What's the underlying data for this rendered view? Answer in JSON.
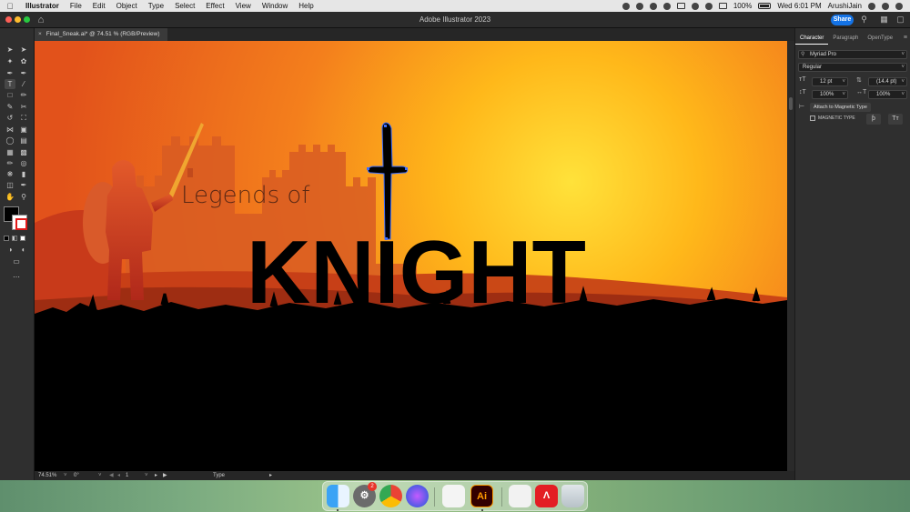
{
  "menubar": {
    "items": [
      "Illustrator",
      "File",
      "Edit",
      "Object",
      "Type",
      "Select",
      "Effect",
      "View",
      "Window",
      "Help"
    ],
    "battery": "100%",
    "clock": "Wed 6:01 PM",
    "user": "ArushiJain"
  },
  "titlebar": {
    "title": "Adobe Illustrator 2023",
    "share_label": "Share"
  },
  "document": {
    "tab_label": "Final_Sneak.ai* @ 74.51 % (RGB/Preview)",
    "close": "×"
  },
  "artwork": {
    "headline_small": "Legends of",
    "headline_big": "KNIGHT",
    "colors": {
      "sky_top": "#e8651c",
      "sky_glow": "#ffd028",
      "silhouette": "#000000",
      "castle": "#d4561d",
      "knight": "#d0421f"
    }
  },
  "status": {
    "zoom": "74.51%",
    "rotation": "0°",
    "artboard": "1",
    "tool": "Type"
  },
  "panel": {
    "tabs": [
      "Character",
      "Paragraph",
      "OpenType"
    ],
    "font_family": "Myriad Pro",
    "font_style": "Regular",
    "font_size": "12 pt",
    "leading": "(14.4 pt)",
    "vertical_scale": "100%",
    "horizontal_scale": "100%",
    "attach_label": "Attach to Magnetic Type",
    "magnetic_label": "MAGNETIC TYPE"
  },
  "dock": {
    "apps": [
      "finder-icon",
      "system-preferences-icon",
      "chrome-icon",
      "siri-icon",
      "notes-icon",
      "illustrator-icon",
      "document-icon",
      "acrobat-icon",
      "trash-icon"
    ],
    "illustrator_label": "Ai",
    "badge": "2"
  }
}
